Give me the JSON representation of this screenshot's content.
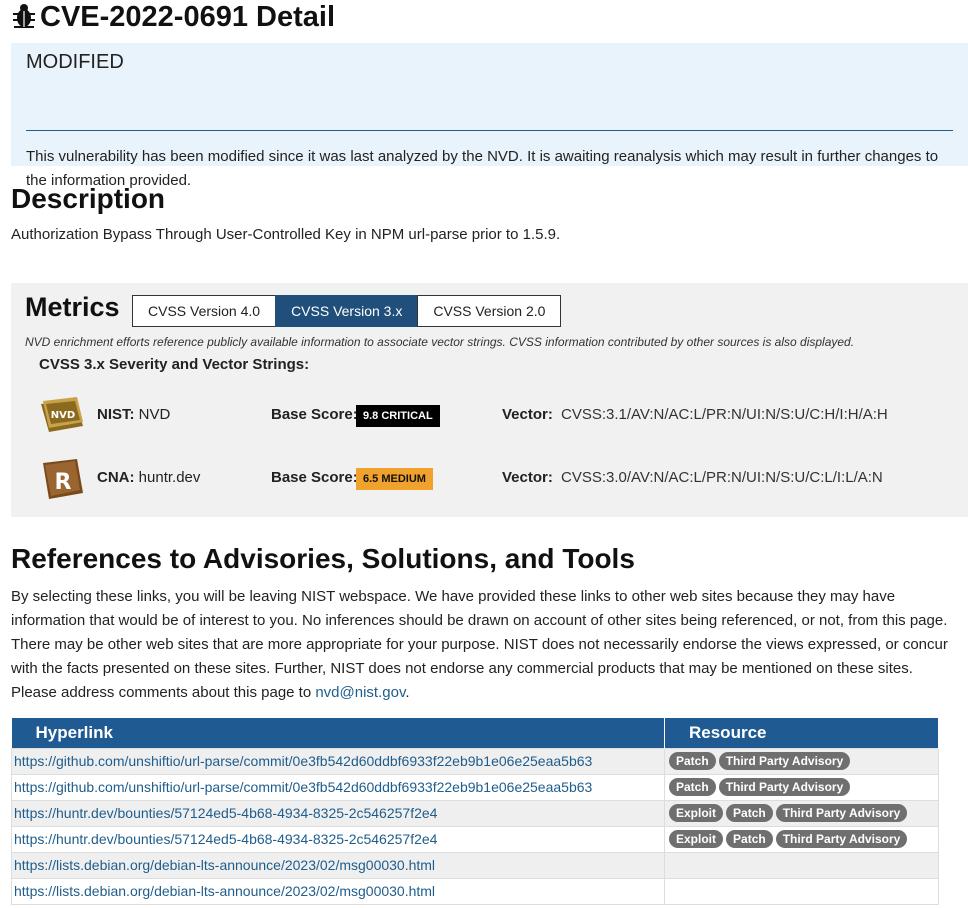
{
  "page": {
    "title": "CVE-2022-0691 Detail"
  },
  "modified": {
    "heading": "MODIFIED",
    "text": "This vulnerability has been modified since it was last analyzed by the NVD. It is awaiting reanalysis which may result in further changes to the information provided."
  },
  "description": {
    "heading": "Description",
    "text": "Authorization Bypass Through User-Controlled Key in NPM url-parse prior to 1.5.9."
  },
  "metrics": {
    "heading": "Metrics",
    "tabs": [
      "CVSS Version 4.0",
      "CVSS Version 3.x",
      "CVSS Version 2.0"
    ],
    "active_tab": "CVSS Version 3.x",
    "note": "NVD enrichment efforts reference publicly available information to associate vector strings. CVSS information contributed by other sources is also displayed.",
    "severity_heading": "CVSS 3.x Severity and Vector Strings:",
    "rows": [
      {
        "logo": "nvd-logo-icon",
        "source_label": "NIST:",
        "source_value": "NVD",
        "base_score_label": "Base Score:",
        "badge": "9.8 CRITICAL",
        "badge_color": "#000000",
        "vector_label": "Vector:",
        "vector": "CVSS:3.1/AV:N/AC:L/PR:N/UI:N/S:U/C:H/I:H/A:H"
      },
      {
        "logo": "cna-logo-icon",
        "source_label": "CNA:",
        "source_value": "huntr.dev",
        "base_score_label": "Base Score:",
        "badge": "6.5 MEDIUM",
        "badge_color": "#f0a22c",
        "vector_label": "Vector:",
        "vector": "CVSS:3.0/AV:N/AC:L/PR:N/UI:N/S:U/C:L/I:L/A:N"
      }
    ]
  },
  "references": {
    "heading": "References to Advisories, Solutions, and Tools",
    "text_before": "By selecting these links, you will be leaving NIST webspace. We have provided these links to other web sites because they may have information that would be of interest to you. No inferences should be drawn on account of other sites being referenced, or not, from this page. There may be other web sites that are more appropriate for your purpose. NIST does not necessarily endorse the views expressed, or concur with the facts presented on these sites. Further, NIST does not endorse any commercial products that may be mentioned on these sites. Please address comments about this page to ",
    "email": "nvd@nist.gov",
    "text_after": ".",
    "columns": [
      "Hyperlink",
      "Resource"
    ],
    "rows": [
      {
        "url": "https://github.com/unshiftio/url-parse/commit/0e3fb542d60ddbf6933f22eb9b1e06e25eaa5b63",
        "tags": [
          "Patch",
          "Third Party Advisory"
        ]
      },
      {
        "url": "https://github.com/unshiftio/url-parse/commit/0e3fb542d60ddbf6933f22eb9b1e06e25eaa5b63",
        "tags": [
          "Patch",
          "Third Party Advisory"
        ]
      },
      {
        "url": "https://huntr.dev/bounties/57124ed5-4b68-4934-8325-2c546257f2e4",
        "tags": [
          "Exploit",
          "Patch",
          "Third Party Advisory"
        ]
      },
      {
        "url": "https://huntr.dev/bounties/57124ed5-4b68-4934-8325-2c546257f2e4",
        "tags": [
          "Exploit",
          "Patch",
          "Third Party Advisory"
        ]
      },
      {
        "url": "https://lists.debian.org/debian-lts-announce/2023/02/msg00030.html",
        "tags": []
      },
      {
        "url": "https://lists.debian.org/debian-lts-announce/2023/02/msg00030.html",
        "tags": []
      }
    ]
  }
}
